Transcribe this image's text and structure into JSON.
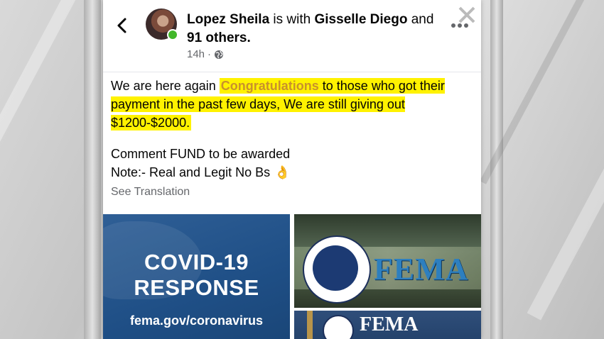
{
  "post": {
    "author": "Lopez Sheila",
    "with_text": " is with ",
    "tagged": "Gisselle Diego",
    "and_text": " and ",
    "others": "91 others.",
    "time": "14h",
    "time_separator": "·",
    "privacy_icon": "globe-icon",
    "body": {
      "line1_before": "We are here again ",
      "highlight_word": "Congratulations",
      "line1_after": " to those who got their payment in the past few days, We are still giving out $1200-$2000.",
      "comment_line": "Comment FUND to be awarded",
      "note_line": "Note:- Real and Legit No Bs",
      "emoji": "👌"
    },
    "see_translation": "See Translation"
  },
  "photos": {
    "left": {
      "title_line1": "COVID-19",
      "title_line2": "RESPONSE",
      "url": "fema.gov/coronavirus"
    },
    "right_top": {
      "logo_text": "FEMA"
    },
    "right_bottom": {
      "logo_text": "FEMA"
    }
  },
  "colors": {
    "highlight": "#fff200",
    "highlight_word": "#c9912c",
    "online": "#42b72a",
    "fema_blue": "#2d7fbf",
    "covid_bg": "#1f4f86"
  }
}
